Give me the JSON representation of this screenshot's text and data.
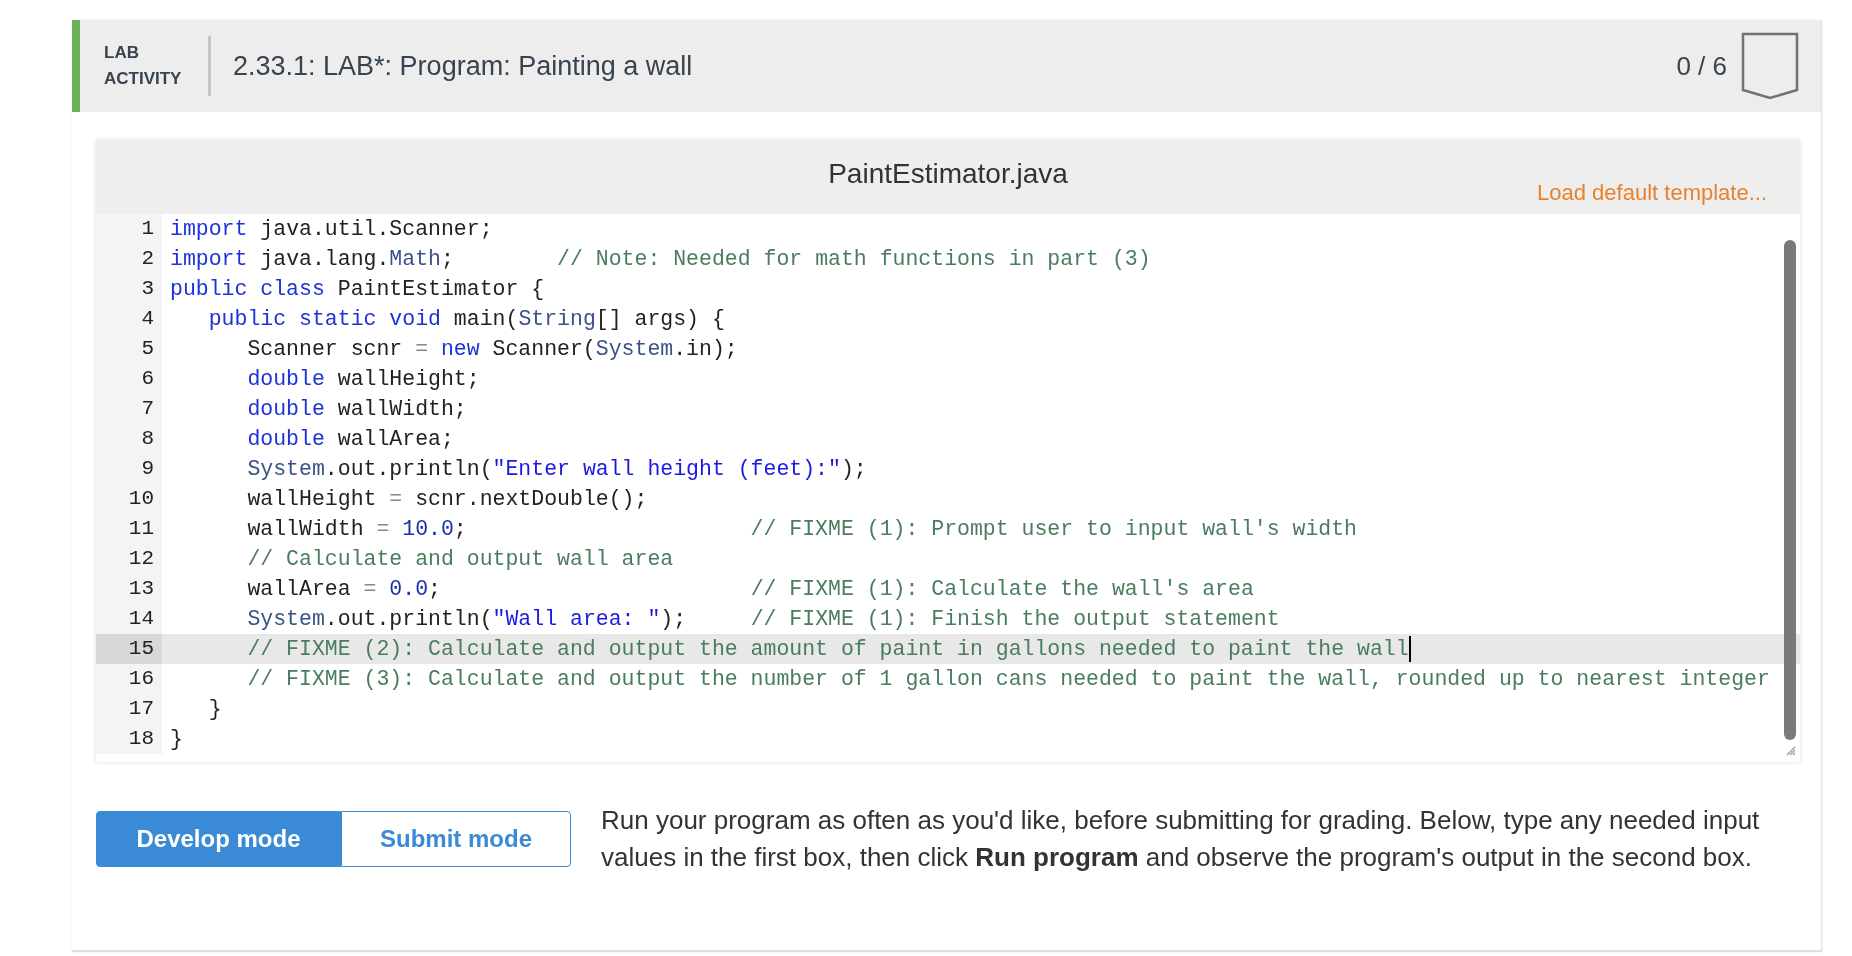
{
  "header": {
    "tag": "LAB ACTIVITY",
    "title": "2.33.1: LAB*: Program: Painting a wall",
    "score": "0 / 6"
  },
  "editor": {
    "filename": "PaintEstimator.java",
    "template_link": "Load default template...",
    "lines": [
      {
        "number": "1",
        "active": false,
        "tokens": [
          {
            "text": "import",
            "kind": "keyword"
          },
          {
            "text": " java.util.Scanner;",
            "kind": "plain"
          }
        ]
      },
      {
        "number": "2",
        "active": false,
        "tokens": [
          {
            "text": "import",
            "kind": "keyword"
          },
          {
            "text": " java.lang.",
            "kind": "plain"
          },
          {
            "text": "Math",
            "kind": "type"
          },
          {
            "text": ";        ",
            "kind": "plain"
          },
          {
            "text": "// Note: Needed for math functions in part (3)",
            "kind": "comment"
          }
        ]
      },
      {
        "number": "3",
        "active": false,
        "tokens": [
          {
            "text": "public class",
            "kind": "keyword"
          },
          {
            "text": " PaintEstimator {",
            "kind": "plain"
          }
        ]
      },
      {
        "number": "4",
        "active": false,
        "tokens": [
          {
            "text": "   public static void",
            "kind": "keyword"
          },
          {
            "text": " main(",
            "kind": "plain"
          },
          {
            "text": "String",
            "kind": "type"
          },
          {
            "text": "[] args) {",
            "kind": "plain"
          }
        ]
      },
      {
        "number": "5",
        "active": false,
        "tokens": [
          {
            "text": "      Scanner scnr ",
            "kind": "plain"
          },
          {
            "text": "=",
            "kind": "operator"
          },
          {
            "text": " new",
            "kind": "keyword"
          },
          {
            "text": " Scanner(",
            "kind": "plain"
          },
          {
            "text": "System",
            "kind": "type"
          },
          {
            "text": ".in);",
            "kind": "plain"
          }
        ]
      },
      {
        "number": "6",
        "active": false,
        "tokens": [
          {
            "text": "      double",
            "kind": "keyword"
          },
          {
            "text": " wallHeight;",
            "kind": "plain"
          }
        ]
      },
      {
        "number": "7",
        "active": false,
        "tokens": [
          {
            "text": "      double",
            "kind": "keyword"
          },
          {
            "text": " wallWidth;",
            "kind": "plain"
          }
        ]
      },
      {
        "number": "8",
        "active": false,
        "tokens": [
          {
            "text": "      double",
            "kind": "keyword"
          },
          {
            "text": " wallArea;",
            "kind": "plain"
          }
        ]
      },
      {
        "number": "9",
        "active": false,
        "tokens": [
          {
            "text": "      System",
            "kind": "type"
          },
          {
            "text": ".out.println(",
            "kind": "plain"
          },
          {
            "text": "\"Enter wall height (feet):\"",
            "kind": "string"
          },
          {
            "text": ");",
            "kind": "plain"
          }
        ]
      },
      {
        "number": "10",
        "active": false,
        "tokens": [
          {
            "text": "      wallHeight ",
            "kind": "plain"
          },
          {
            "text": "=",
            "kind": "operator"
          },
          {
            "text": " scnr.nextDouble();",
            "kind": "plain"
          }
        ]
      },
      {
        "number": "11",
        "active": false,
        "tokens": [
          {
            "text": "      wallWidth ",
            "kind": "plain"
          },
          {
            "text": "=",
            "kind": "operator"
          },
          {
            "text": " 10.0",
            "kind": "number"
          },
          {
            "text": ";                      ",
            "kind": "plain"
          },
          {
            "text": "// FIXME (1): Prompt user to input wall's width",
            "kind": "comment"
          }
        ]
      },
      {
        "number": "12",
        "active": false,
        "tokens": [
          {
            "text": "      // Calculate and output wall area",
            "kind": "comment"
          }
        ]
      },
      {
        "number": "13",
        "active": false,
        "tokens": [
          {
            "text": "      wallArea ",
            "kind": "plain"
          },
          {
            "text": "=",
            "kind": "operator"
          },
          {
            "text": " 0.0",
            "kind": "number"
          },
          {
            "text": ";                        ",
            "kind": "plain"
          },
          {
            "text": "// FIXME (1): Calculate the wall's area",
            "kind": "comment"
          }
        ]
      },
      {
        "number": "14",
        "active": false,
        "tokens": [
          {
            "text": "      System",
            "kind": "type"
          },
          {
            "text": ".out.println(",
            "kind": "plain"
          },
          {
            "text": "\"Wall area: \"",
            "kind": "string"
          },
          {
            "text": ");     ",
            "kind": "plain"
          },
          {
            "text": "// FIXME (1): Finish the output statement",
            "kind": "comment"
          }
        ]
      },
      {
        "number": "15",
        "active": true,
        "tokens": [
          {
            "text": "      // FIXME (2): Calculate and output the amount of paint in gallons needed to paint the wall",
            "kind": "comment"
          }
        ]
      },
      {
        "number": "16",
        "active": false,
        "tokens": [
          {
            "text": "      // FIXME (3): Calculate and output the number of 1 gallon cans needed to paint the wall, rounded up to nearest integer",
            "kind": "comment"
          }
        ]
      },
      {
        "number": "17",
        "active": false,
        "tokens": [
          {
            "text": "   }",
            "kind": "plain"
          }
        ]
      },
      {
        "number": "18",
        "active": false,
        "tokens": [
          {
            "text": "}",
            "kind": "plain"
          }
        ]
      }
    ]
  },
  "modes": [
    {
      "label": "Develop mode",
      "selected": true
    },
    {
      "label": "Submit mode",
      "selected": false
    }
  ],
  "instructions": "Run your program as often as you'd like, before submitting for grading. Below, type any needed input values in the first box, then click **Run program** and observe the program's output in the second box."
}
